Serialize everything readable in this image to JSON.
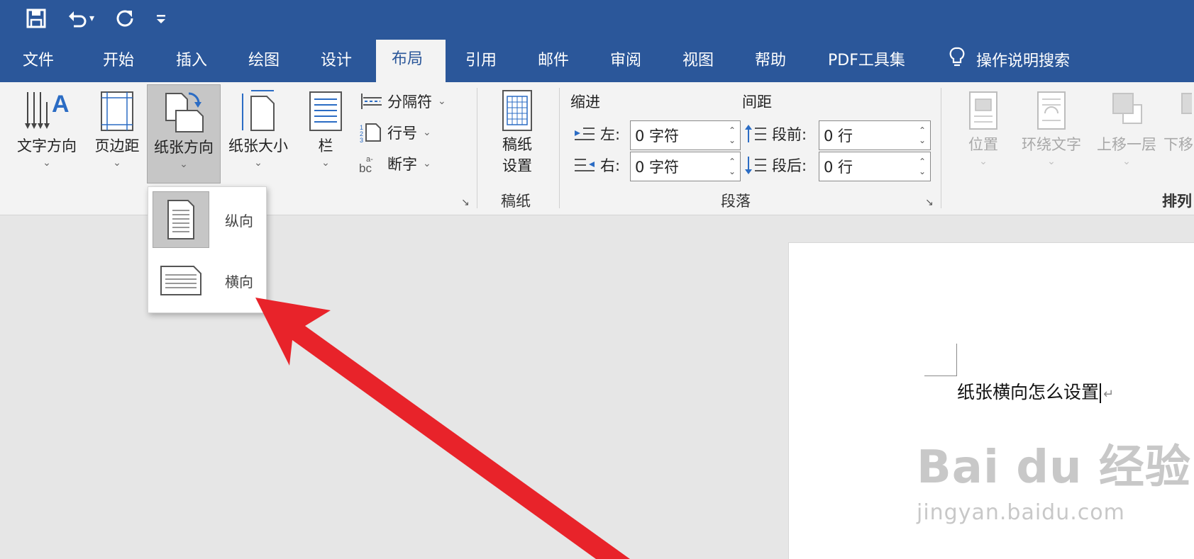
{
  "quick_access": {
    "save": "save-icon",
    "undo": "undo-icon",
    "undo_dropdown": "▾",
    "redo": "redo-icon",
    "customize": "customize-icon"
  },
  "tabs": [
    {
      "label": "文件"
    },
    {
      "label": "开始"
    },
    {
      "label": "插入"
    },
    {
      "label": "绘图"
    },
    {
      "label": "设计"
    },
    {
      "label": "布局"
    },
    {
      "label": "引用"
    },
    {
      "label": "邮件"
    },
    {
      "label": "审阅"
    },
    {
      "label": "视图"
    },
    {
      "label": "帮助"
    },
    {
      "label": "PDF工具集"
    }
  ],
  "tell_me": {
    "label": "操作说明搜索"
  },
  "ribbon": {
    "page_setup": {
      "text_direction": "文字方向",
      "margins": "页边距",
      "orientation": "纸张方向",
      "size": "纸张大小",
      "columns": "栏",
      "breaks": "分隔符",
      "line_numbers": "行号",
      "hyphenation": "断字"
    },
    "manuscript": {
      "button_line1": "稿纸",
      "button_line2": "设置",
      "group_label": "稿纸"
    },
    "paragraph": {
      "indent_title": "缩进",
      "spacing_title": "间距",
      "left_label": "左:",
      "right_label": "右:",
      "left_value": "0 字符",
      "right_value": "0 字符",
      "before_label": "段前:",
      "after_label": "段后:",
      "before_value": "0 行",
      "after_value": "0 行",
      "group_label": "段落"
    },
    "arrange": {
      "position": "位置",
      "wrap_text": "环绕文字",
      "bring_forward": "上移一层",
      "send_backward": "下移",
      "group_label": "排列"
    }
  },
  "orientation_menu": {
    "portrait": "纵向",
    "landscape": "横向",
    "selected": "portrait"
  },
  "document": {
    "text": "纸张横向怎么设置",
    "paragraph_mark": "↵"
  },
  "watermark": {
    "main": "Bai du 经验",
    "sub": "jingyan.baidu.com"
  },
  "colors": {
    "title_bar": "#2b579a",
    "ribbon": "#f3f3f3",
    "arrow": "#e8232a"
  }
}
